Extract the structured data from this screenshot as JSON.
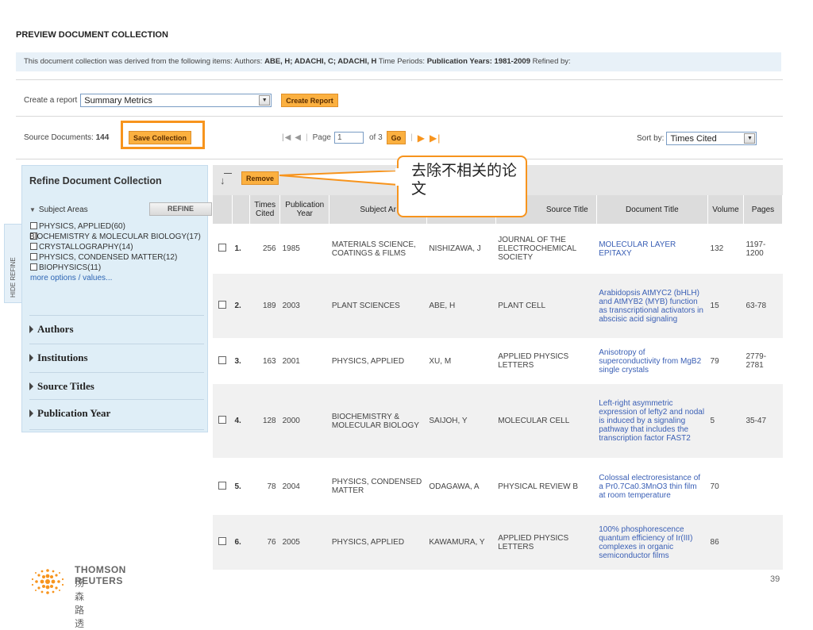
{
  "page_title": "PREVIEW DOCUMENT COLLECTION",
  "info": {
    "prefix": "This document collection was derived from the following items: Authors:",
    "authors": "ABE, H; ADACHI, C; ADACHI, H",
    "time_label": "Time Periods:",
    "pub_years": "Publication Years: 1981-2009",
    "refined": "Refined by:"
  },
  "report": {
    "label": "Create a report",
    "selected": "Summary Metrics",
    "button": "Create Report"
  },
  "source": {
    "label": "Source Documents:",
    "count": "144",
    "save_button": "Save Collection"
  },
  "pager": {
    "page_label": "Page",
    "page_value": "1",
    "of_label": "of 3",
    "go": "Go"
  },
  "sort": {
    "label": "Sort by:",
    "selected": "Times Cited"
  },
  "refine": {
    "title": "Refine Document Collection",
    "subject_heading": "Subject Areas",
    "refine_button": "REFINE",
    "subjects": [
      "PHYSICS, APPLIED(60)",
      "BIOCHEMISTRY & MOLECULAR BIOLOGY(17)",
      "CRYSTALLOGRAPHY(14)",
      "PHYSICS, CONDENSED MATTER(12)",
      "BIOPHYSICS(11)"
    ],
    "more": "more options / values...",
    "facets": [
      "Authors",
      "Institutions",
      "Source Titles",
      "Publication Year"
    ]
  },
  "hide_tab": "HIDE REFINE",
  "remove_button": "Remove",
  "table": {
    "headers": [
      "",
      "",
      "Times Cited",
      "Publication Year",
      "Subject Ar",
      "",
      "Source Title",
      "Document Title",
      "Volume",
      "Pages"
    ],
    "rows": [
      {
        "num": "1.",
        "cited": "256",
        "year": "1985",
        "subject": "MATERIALS SCIENCE, COATINGS & FILMS",
        "author": "NISHIZAWA, J",
        "source": "JOURNAL OF THE ELECTROCHEMICAL SOCIETY",
        "title": "MOLECULAR LAYER EPITAXY",
        "volume": "132",
        "pages": "1197-1200"
      },
      {
        "num": "2.",
        "cited": "189",
        "year": "2003",
        "subject": "PLANT SCIENCES",
        "author": "ABE, H",
        "source": "PLANT CELL",
        "title": "Arabidopsis AtMYC2 (bHLH) and AtMYB2 (MYB) function as transcriptional activators in abscisic acid signaling",
        "volume": "15",
        "pages": "63-78"
      },
      {
        "num": "3.",
        "cited": "163",
        "year": "2001",
        "subject": "PHYSICS, APPLIED",
        "author": "XU, M",
        "source": "APPLIED PHYSICS LETTERS",
        "title": "Anisotropy of superconductivity from MgB2 single crystals",
        "volume": "79",
        "pages": "2779-2781"
      },
      {
        "num": "4.",
        "cited": "128",
        "year": "2000",
        "subject": "BIOCHEMISTRY & MOLECULAR BIOLOGY",
        "author": "SAIJOH, Y",
        "source": "MOLECULAR CELL",
        "title": "Left-right asymmetric expression of lefty2 and nodal is induced by a signaling pathway that includes the transcription factor FAST2",
        "volume": "5",
        "pages": "35-47"
      },
      {
        "num": "5.",
        "cited": "78",
        "year": "2004",
        "subject": "PHYSICS, CONDENSED MATTER",
        "author": "ODAGAWA, A",
        "source": "PHYSICAL REVIEW B",
        "title": "Colossal electroresistance of a Pr0.7Ca0.3MnO3 thin film at room temperature",
        "volume": "70",
        "pages": ""
      },
      {
        "num": "6.",
        "cited": "76",
        "year": "2005",
        "subject": "PHYSICS, APPLIED",
        "author": "KAWAMURA, Y",
        "source": "APPLIED PHYSICS LETTERS",
        "title": "100% phosphorescence quantum efficiency of Ir(III) complexes in organic semiconductor films",
        "volume": "86",
        "pages": ""
      }
    ]
  },
  "callout": "去除不相关的论文",
  "footer": {
    "brand_en": "THOMSON REUTERS",
    "brand_cn": "汤森路透",
    "page_number": "39"
  },
  "colors": {
    "accent_orange": "#f7941d",
    "link_blue": "#2d65b4",
    "panel_blue": "#dfeef7"
  }
}
